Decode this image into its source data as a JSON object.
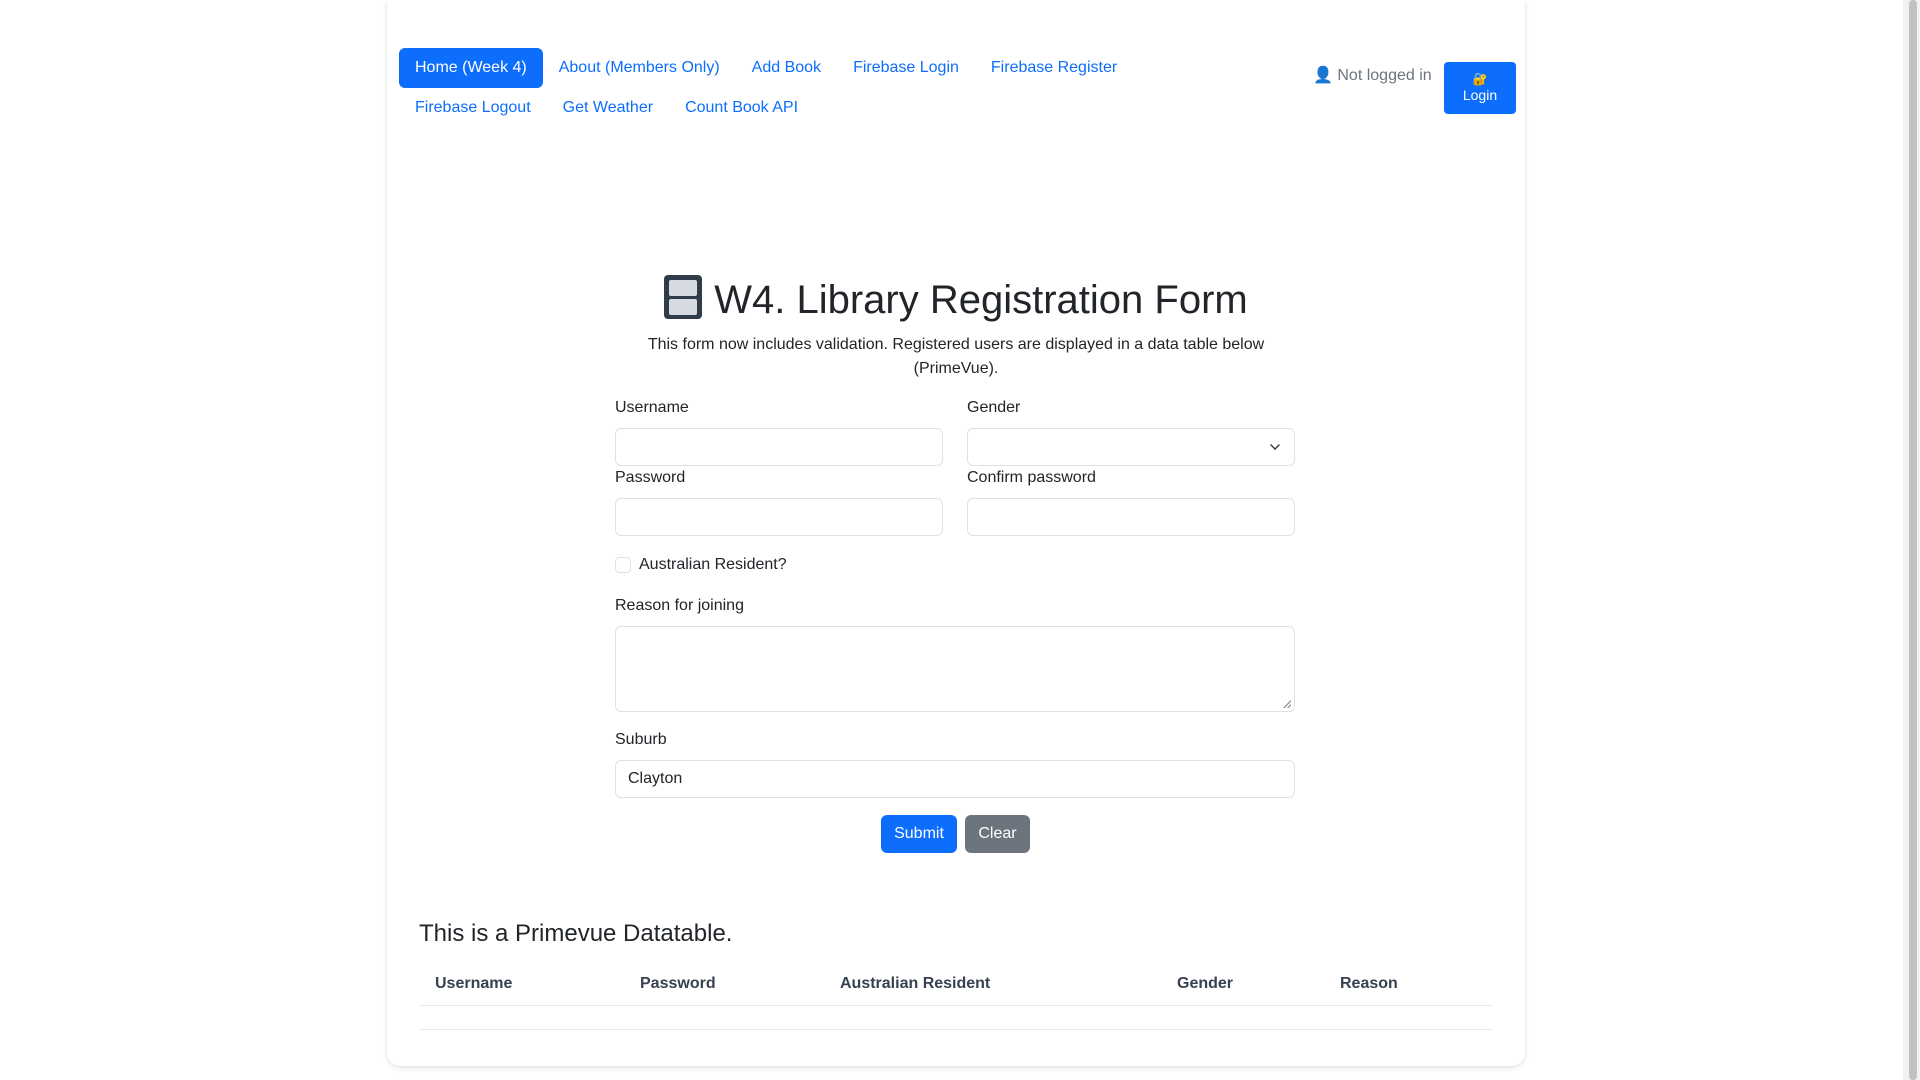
{
  "nav": {
    "links": [
      {
        "label": "Home (Week 4)",
        "active": true
      },
      {
        "label": "About (Members Only)"
      },
      {
        "label": "Add Book"
      },
      {
        "label": "Firebase Login"
      },
      {
        "label": "Firebase Register"
      },
      {
        "label": "Firebase Logout"
      },
      {
        "label": "Get Weather"
      },
      {
        "label": "Count Book API"
      }
    ],
    "user_status": "👤 Not logged in",
    "login_icon": "🔐",
    "login_label": "Login"
  },
  "form": {
    "title": "W4. Library Registration Form",
    "title_icon": "file-cabinet-icon",
    "subtitle": "This form now includes validation. Registered users are displayed in a data table below (PrimeVue).",
    "username_label": "Username",
    "username_value": "",
    "gender_label": "Gender",
    "gender_value": "",
    "password_label": "Password",
    "password_value": "",
    "confirm_password_label": "Confirm password",
    "confirm_password_value": "",
    "resident_label": "Australian Resident?",
    "resident_checked": false,
    "reason_label": "Reason for joining",
    "reason_value": "",
    "suburb_label": "Suburb",
    "suburb_value": "Clayton",
    "submit_label": "Submit",
    "clear_label": "Clear"
  },
  "table": {
    "title": "This is a Primevue Datatable.",
    "columns": [
      "Username",
      "Password",
      "Australian Resident",
      "Gender",
      "Reason"
    ],
    "rows": []
  },
  "colors": {
    "primary": "#0d6efd",
    "secondary": "#6c757d",
    "text": "#212529"
  }
}
